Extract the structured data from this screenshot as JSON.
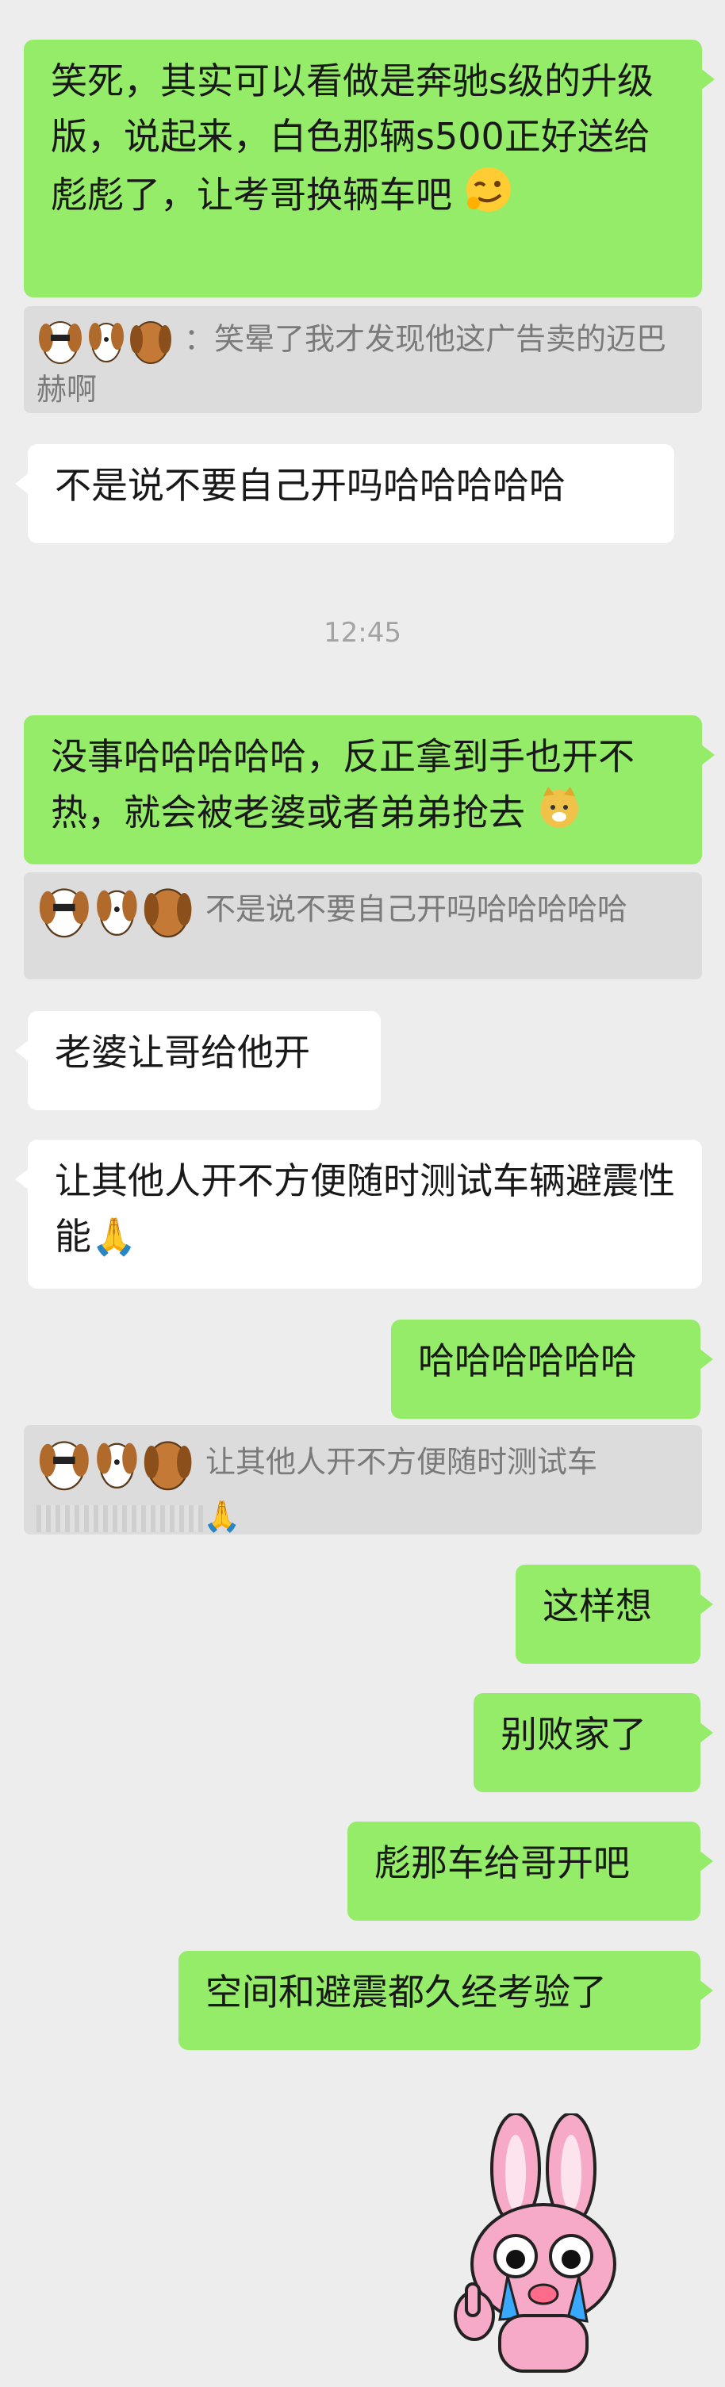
{
  "messages": {
    "m1": {
      "text": "笑死，其实可以看做是奔驰s级的升级版，说起来，白色那辆s500正好送给彪彪了，让考哥换辆车吧",
      "emoji": "smirk-wink-emoji"
    },
    "q1": {
      "sep": "：",
      "text": "笑晕了我才发现他这广告卖的迈巴赫啊"
    },
    "m2": {
      "text": "不是说不要自己开吗哈哈哈哈哈"
    },
    "time1": "12:45",
    "m3": {
      "text": "没事哈哈哈哈哈，反正拿到手也开不热，就会被老婆或者弟弟抢去",
      "emoji": "doge-emoji"
    },
    "q2": {
      "text": "不是说不要自己开吗哈哈哈哈哈"
    },
    "m4": {
      "text": "老婆让哥给他开"
    },
    "m5": {
      "text": "让其他人开不方便随时测试车辆避震性能🙏"
    },
    "m6": {
      "text": "哈哈哈哈哈哈"
    },
    "q3": {
      "text": "让其他人开不方便随时测试车",
      "tail": "🙏"
    },
    "m7": {
      "text": "这样想"
    },
    "m8": {
      "text": "别败家了"
    },
    "m9": {
      "text": "彪那车给哥开吧"
    },
    "m10": {
      "text": "空间和避震都久经考验了"
    },
    "sticker": {
      "icon": "crying-pink-bunny-sticker"
    }
  },
  "colors": {
    "outgoing": "#95ec69",
    "incoming": "#ffffff",
    "background": "#ededed",
    "quote": "#dcdcdc"
  }
}
